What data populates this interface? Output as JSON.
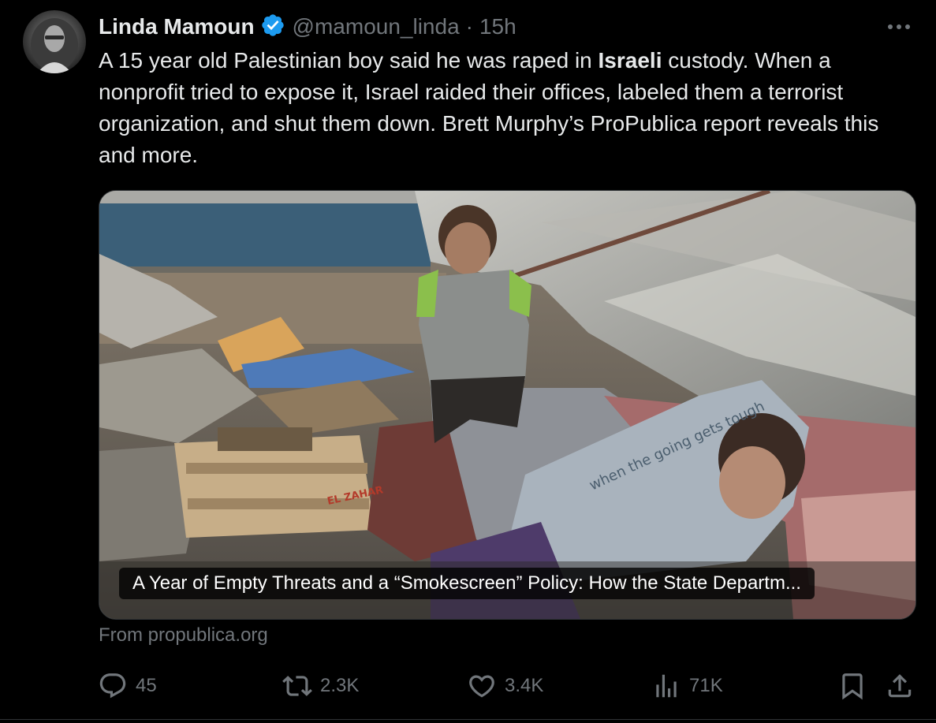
{
  "author": {
    "name": "Linda Mamoun",
    "handle": "@mamoun_linda",
    "separator": "·",
    "time": "15h"
  },
  "tweet": {
    "text_before": "A 15 year old Palestinian boy said he was raped in ",
    "text_bold": "Israeli",
    "text_after": " custody. When a nonprofit tried to expose it, Israel raided their offices, labeled them a terrorist organization, and shut them down. Brett Murphy’s ProPublica report reveals this and more."
  },
  "card": {
    "title": "A Year of Empty Threats and a “Smokescreen” Policy: How the State Departm...",
    "source": "From propublica.org",
    "photo_label": "EL ZAHAR",
    "shirt_label": "when the going gets tough"
  },
  "actions": {
    "replies": "45",
    "reposts": "2.3K",
    "likes": "3.4K",
    "views": "71K"
  },
  "colors": {
    "background": "#000000",
    "text_primary": "#e7e9ea",
    "text_secondary": "#71767b",
    "verified": "#1d9bf0",
    "border": "#2f3336"
  },
  "icons": [
    "more-icon",
    "verified-badge-icon",
    "reply-icon",
    "repost-icon",
    "like-icon",
    "views-icon",
    "bookmark-icon",
    "share-icon"
  ]
}
